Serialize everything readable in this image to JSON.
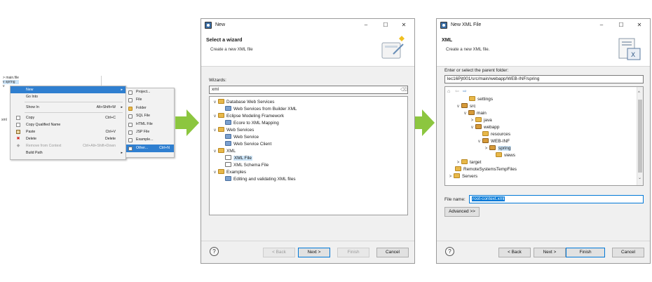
{
  "panel1": {
    "tree": [
      {
        "label": "main.file",
        "twisty": ">"
      },
      {
        "label": "spring",
        "twisty": "v"
      },
      {
        "label": "",
        "twisty": "v"
      }
    ],
    "left_stub": "xml",
    "context_menu": [
      {
        "label": "New",
        "shortcut": "",
        "submenu": true,
        "highlighted": true,
        "icon": "",
        "disabled": false
      },
      {
        "label": "Go Into",
        "shortcut": "",
        "submenu": false,
        "highlighted": false,
        "icon": "",
        "disabled": false
      },
      {
        "sep": true
      },
      {
        "label": "Show In",
        "shortcut": "Alt+Shift+W",
        "submenu": true,
        "highlighted": false,
        "icon": "",
        "disabled": false
      },
      {
        "sep": true
      },
      {
        "label": "Copy",
        "shortcut": "Ctrl+C",
        "submenu": false,
        "highlighted": false,
        "icon": "copy-icon",
        "disabled": false
      },
      {
        "label": "Copy Qualified Name",
        "shortcut": "",
        "submenu": false,
        "highlighted": false,
        "icon": "copy-icon",
        "disabled": false
      },
      {
        "label": "Paste",
        "shortcut": "Ctrl+V",
        "submenu": false,
        "highlighted": false,
        "icon": "paste-icon",
        "disabled": false
      },
      {
        "label": "Delete",
        "shortcut": "Delete",
        "submenu": false,
        "highlighted": false,
        "icon": "delete-icon",
        "disabled": false
      },
      {
        "label": "Remove from Context",
        "shortcut": "Ctrl+Alt+Shift+Down",
        "submenu": false,
        "highlighted": false,
        "icon": "remove-icon",
        "disabled": true
      },
      {
        "label": "Build Path",
        "shortcut": "",
        "submenu": true,
        "highlighted": false,
        "icon": "",
        "disabled": false
      }
    ],
    "submenu": [
      {
        "label": "Project...",
        "shortcut": ""
      },
      {
        "label": "File",
        "shortcut": ""
      },
      {
        "label": "Folder",
        "shortcut": ""
      },
      {
        "label": "SQL File",
        "shortcut": ""
      },
      {
        "label": "HTML File",
        "shortcut": ""
      },
      {
        "label": "JSP File",
        "shortcut": ""
      },
      {
        "label": "Example...",
        "shortcut": ""
      },
      {
        "label": "Other...",
        "shortcut": "Ctrl+N",
        "highlighted": true
      }
    ]
  },
  "arrow_color": "#8cc63f",
  "dialog_new": {
    "title": "New",
    "header_title": "Select a wizard",
    "header_subtitle": "Create a new XML file",
    "wizards_label": "Wizards:",
    "filter_value": "xml",
    "tree": [
      {
        "label": "Database Web Services",
        "level": 0,
        "twisty": "v",
        "icon": "folder"
      },
      {
        "label": "Web Services from Builder XML",
        "level": 1,
        "twisty": "",
        "icon": "gear"
      },
      {
        "label": "Eclipse Modeling Framework",
        "level": 0,
        "twisty": "v",
        "icon": "folder"
      },
      {
        "label": "Ecore to XML Mapping",
        "level": 1,
        "twisty": "",
        "icon": "gear"
      },
      {
        "label": "Web Services",
        "level": 0,
        "twisty": "v",
        "icon": "folder"
      },
      {
        "label": "Web Service",
        "level": 1,
        "twisty": "",
        "icon": "gear"
      },
      {
        "label": "Web Service Client",
        "level": 1,
        "twisty": "",
        "icon": "gear"
      },
      {
        "label": "XML",
        "level": 0,
        "twisty": "v",
        "icon": "folder"
      },
      {
        "label": "XML File",
        "level": 1,
        "twisty": "",
        "icon": "xml",
        "selected": true
      },
      {
        "label": "XML Schema File",
        "level": 1,
        "twisty": "",
        "icon": "xml"
      },
      {
        "label": "Examples",
        "level": 0,
        "twisty": "v",
        "icon": "folder"
      },
      {
        "label": "Editing and validating XML files",
        "level": 1,
        "twisty": "",
        "icon": "gear"
      }
    ],
    "buttons": {
      "back": "< Back",
      "next": "Next >",
      "finish": "Finish",
      "cancel": "Cancel"
    },
    "help": "?"
  },
  "dialog_xml": {
    "title": "New XML File",
    "header_title": "XML",
    "header_subtitle": "Create a new XML file.",
    "parent_label": "Enter or select the parent folder:",
    "parent_value": "lec16Pjt001/src/main/webapp/WEB-INF/spring",
    "tree": [
      {
        "label": "settings",
        "level": 2,
        "twisty": "",
        "icon": "folder"
      },
      {
        "label": "src",
        "level": 1,
        "twisty": "v",
        "icon": "folder"
      },
      {
        "label": "main",
        "level": 2,
        "twisty": "v",
        "icon": "folder"
      },
      {
        "label": "java",
        "level": 3,
        "twisty": ">",
        "icon": "folder"
      },
      {
        "label": "webapp",
        "level": 3,
        "twisty": "v",
        "icon": "folder"
      },
      {
        "label": "resources",
        "level": 4,
        "twisty": "",
        "icon": "folder"
      },
      {
        "label": "WEB-INF",
        "level": 4,
        "twisty": "v",
        "icon": "folder"
      },
      {
        "label": "spring",
        "level": 5,
        "twisty": ">",
        "icon": "folder",
        "selected": true
      },
      {
        "label": "views",
        "level": 5,
        "twisty": "",
        "icon": "folder"
      },
      {
        "label": "target",
        "level": 1,
        "twisty": ">",
        "icon": "folder"
      },
      {
        "label": "RemoteSystemsTempFiles",
        "level": 0,
        "twisty": "",
        "icon": "folder"
      },
      {
        "label": "Servers",
        "level": 0,
        "twisty": ">",
        "icon": "folder"
      }
    ],
    "filename_label": "File name:",
    "filename_value": "root-context.xml",
    "advanced": "Advanced >>",
    "buttons": {
      "back": "< Back",
      "next": "Next >",
      "finish": "Finish",
      "cancel": "Cancel"
    },
    "help": "?"
  }
}
